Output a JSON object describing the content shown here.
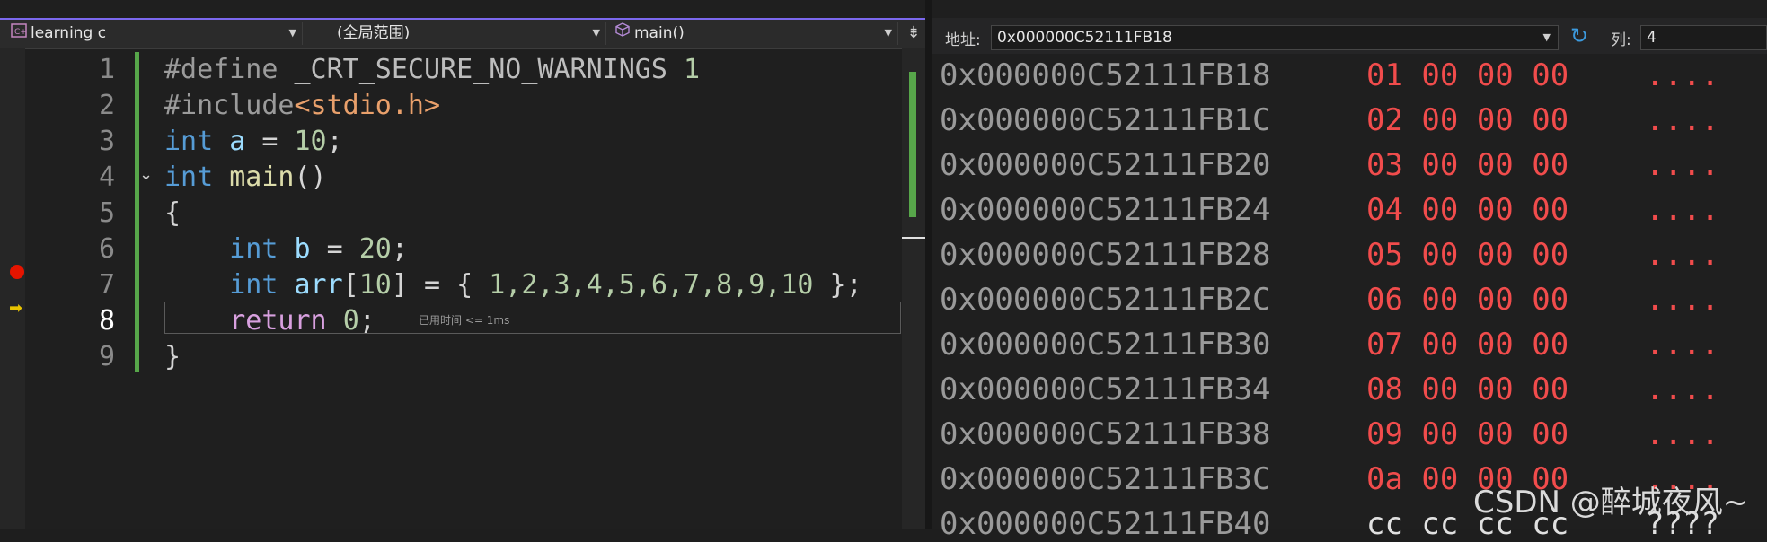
{
  "toolbar": {
    "project": "learning c",
    "scope": "(全局范围)",
    "function": "main()"
  },
  "code_lines": [
    {
      "n": "1",
      "parts": [
        {
          "t": "#define ",
          "c": "pp"
        },
        {
          "t": "_CRT_SECURE_NO_WARNINGS",
          "c": "mac"
        },
        {
          "t": " 1",
          "c": "num"
        }
      ]
    },
    {
      "n": "2",
      "parts": [
        {
          "t": "#include",
          "c": "pp"
        },
        {
          "t": "<stdio.h>",
          "c": "str"
        }
      ]
    },
    {
      "n": "3",
      "parts": [
        {
          "t": "int",
          "c": "kw"
        },
        {
          "t": " a ",
          "c": "id"
        },
        {
          "t": "= ",
          "c": "plain"
        },
        {
          "t": "10",
          "c": "num"
        },
        {
          "t": ";",
          "c": "plain"
        }
      ]
    },
    {
      "n": "4",
      "parts": [
        {
          "t": "int",
          "c": "kw"
        },
        {
          "t": " ",
          "c": "plain"
        },
        {
          "t": "main",
          "c": "fn"
        },
        {
          "t": "()",
          "c": "plain"
        }
      ]
    },
    {
      "n": "5",
      "parts": [
        {
          "t": "{",
          "c": "plain"
        }
      ]
    },
    {
      "n": "6",
      "parts": [
        {
          "t": "    ",
          "c": "plain"
        },
        {
          "t": "int",
          "c": "kw"
        },
        {
          "t": " b ",
          "c": "id"
        },
        {
          "t": "= ",
          "c": "plain"
        },
        {
          "t": "20",
          "c": "num"
        },
        {
          "t": ";",
          "c": "plain"
        }
      ]
    },
    {
      "n": "7",
      "parts": [
        {
          "t": "    ",
          "c": "plain"
        },
        {
          "t": "int",
          "c": "kw"
        },
        {
          "t": " arr",
          "c": "id"
        },
        {
          "t": "[",
          "c": "plain"
        },
        {
          "t": "10",
          "c": "num"
        },
        {
          "t": "] = { ",
          "c": "plain"
        },
        {
          "t": "1,2,3,4,5,6,7,8,9,10",
          "c": "num"
        },
        {
          "t": " };",
          "c": "plain"
        }
      ]
    },
    {
      "n": "8",
      "parts": [
        {
          "t": "    ",
          "c": "plain"
        },
        {
          "t": "return",
          "c": "ret"
        },
        {
          "t": " ",
          "c": "plain"
        },
        {
          "t": "0",
          "c": "num"
        },
        {
          "t": ";",
          "c": "plain"
        }
      ]
    },
    {
      "n": "9",
      "parts": [
        {
          "t": "}",
          "c": "plain"
        }
      ]
    }
  ],
  "current_line": "8",
  "perf_tip": "已用时间 <= 1ms",
  "memory": {
    "address_label": "地址:",
    "address_value": "0x000000C52111FB18",
    "columns_label": "列:",
    "columns_value": "4",
    "rows": [
      {
        "addr": "0x000000C52111FB18",
        "bytes": "01 00 00 00",
        "ascii": "....",
        "kind": "data"
      },
      {
        "addr": "0x000000C52111FB1C",
        "bytes": "02 00 00 00",
        "ascii": "....",
        "kind": "data"
      },
      {
        "addr": "0x000000C52111FB20",
        "bytes": "03 00 00 00",
        "ascii": "....",
        "kind": "data"
      },
      {
        "addr": "0x000000C52111FB24",
        "bytes": "04 00 00 00",
        "ascii": "....",
        "kind": "data"
      },
      {
        "addr": "0x000000C52111FB28",
        "bytes": "05 00 00 00",
        "ascii": "....",
        "kind": "data"
      },
      {
        "addr": "0x000000C52111FB2C",
        "bytes": "06 00 00 00",
        "ascii": "....",
        "kind": "data"
      },
      {
        "addr": "0x000000C52111FB30",
        "bytes": "07 00 00 00",
        "ascii": "....",
        "kind": "data"
      },
      {
        "addr": "0x000000C52111FB34",
        "bytes": "08 00 00 00",
        "ascii": "....",
        "kind": "data"
      },
      {
        "addr": "0x000000C52111FB38",
        "bytes": "09 00 00 00",
        "ascii": "....",
        "kind": "data"
      },
      {
        "addr": "0x000000C52111FB3C",
        "bytes": "0a 00 00 00",
        "ascii": "....",
        "kind": "data"
      },
      {
        "addr": "0x000000C52111FB40",
        "bytes": "cc cc cc cc",
        "ascii": "????",
        "kind": "uninit"
      }
    ]
  },
  "watermark": "CSDN @醉城夜风~"
}
